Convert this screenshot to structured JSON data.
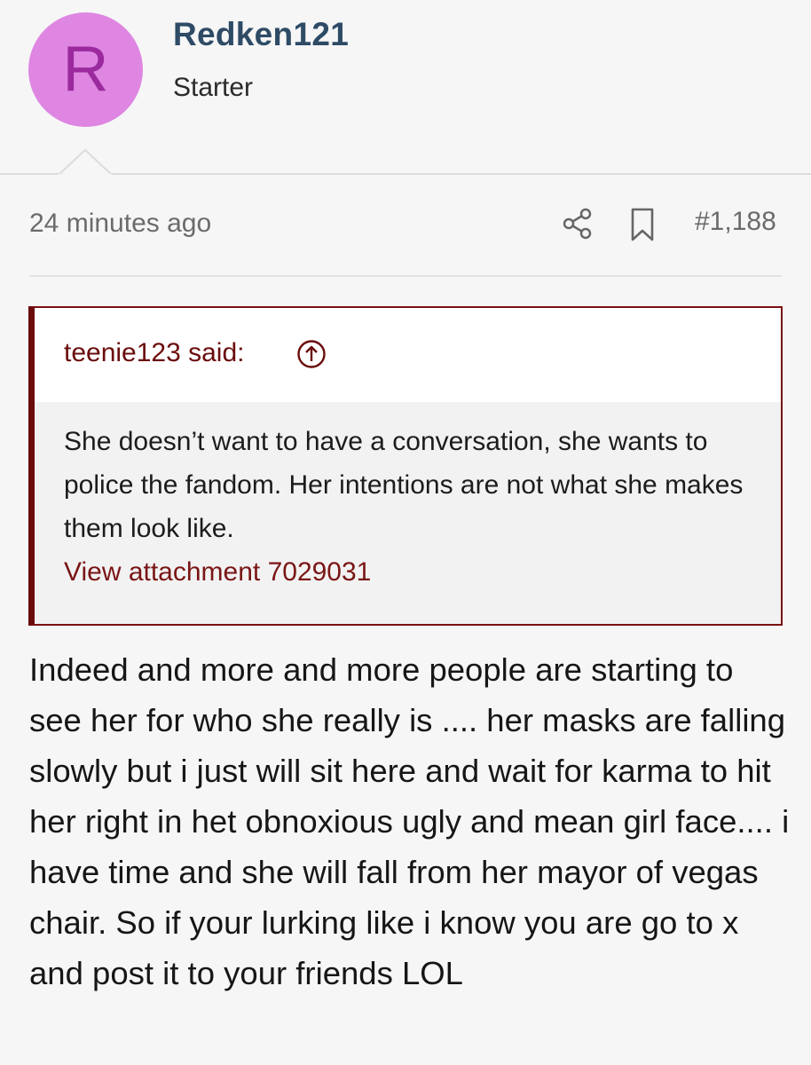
{
  "user": {
    "avatar_letter": "R",
    "avatar_color": "#de86e2",
    "username": "Redken121",
    "title": "Starter"
  },
  "meta": {
    "time": "24 minutes ago",
    "post_number": "#1,188",
    "icons": [
      "share-icon",
      "bookmark-icon"
    ]
  },
  "quote": {
    "author": "teenie123 said:",
    "text": "She doesn’t want to have a conversation, she wants to police the fandom. Her intentions are not what she makes them look like.",
    "attachment_link": "View attachment 7029031",
    "accent_color": "#6a0c0c"
  },
  "post": {
    "body": "Indeed and more and more people are starting to see her for who she really is .... her masks are falling slowly but i just will sit here and wait for karma to hit her right in het obnoxious ugly and mean girl face.... i have time and she will fall from her mayor of vegas chair. So if your lurking like i know you are go to x and post it to your friends LOL"
  }
}
